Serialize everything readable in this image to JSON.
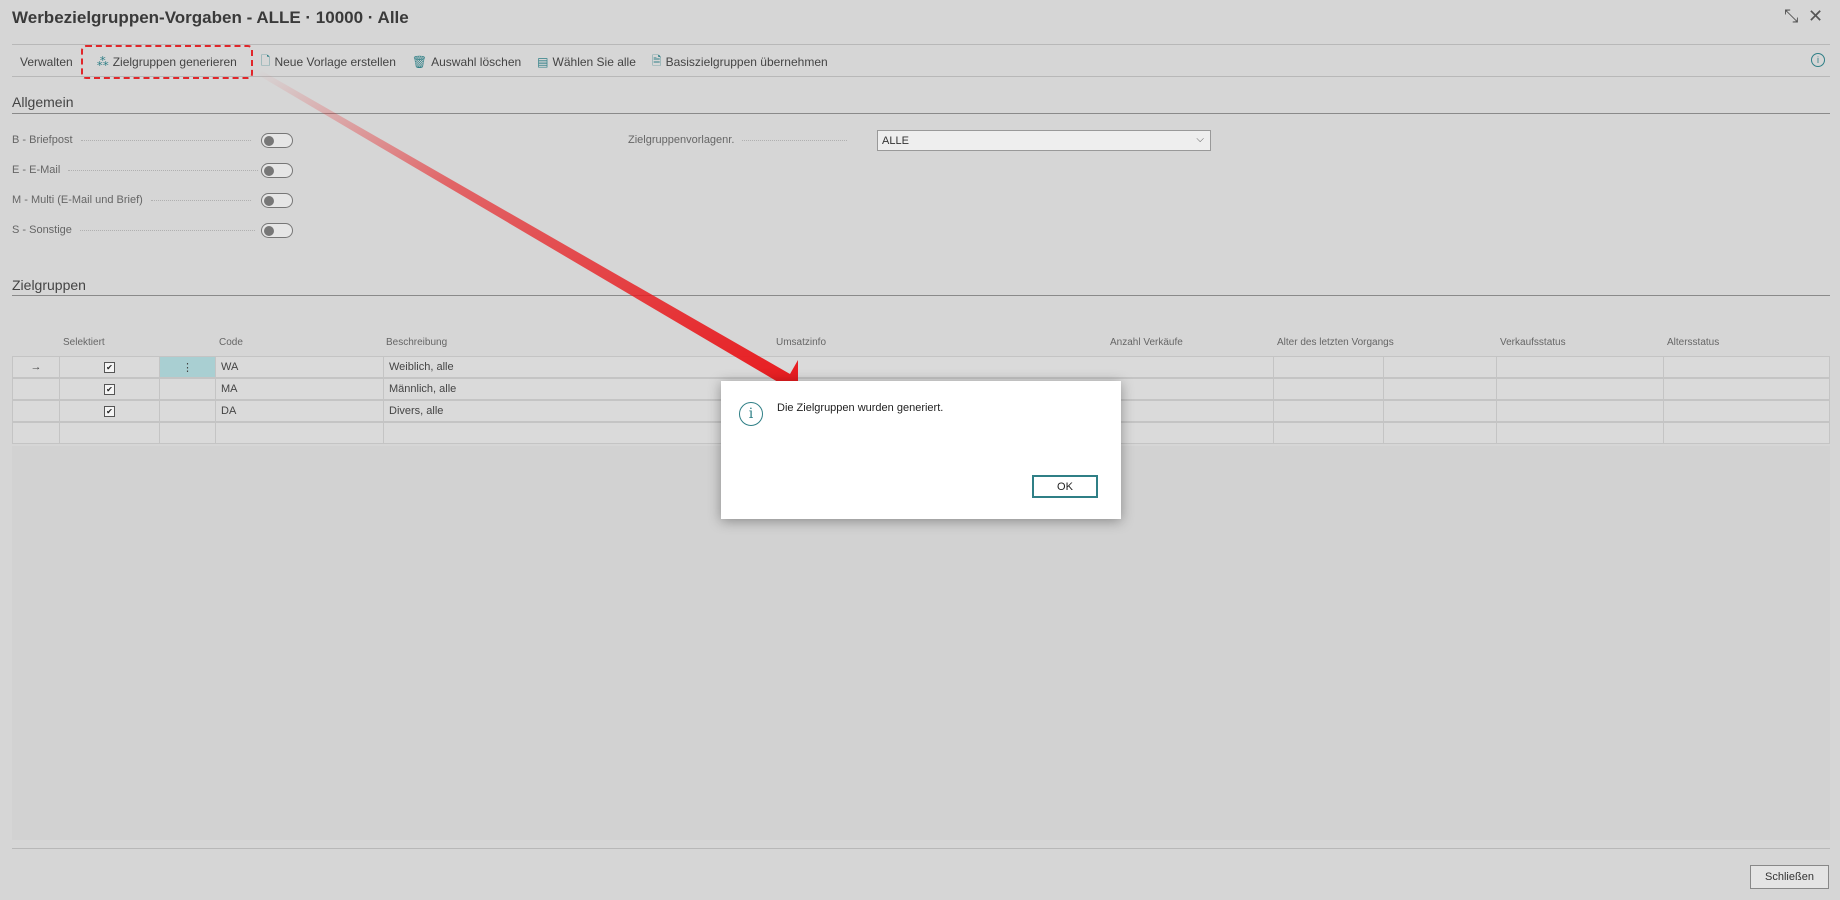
{
  "window": {
    "title": "Werbezielgruppen-Vorgaben - ALLE · 10000 · Alle"
  },
  "toolbar": {
    "verwalten": "Verwalten",
    "generate": "Zielgruppen generieren",
    "new_template": "Neue Vorlage erstellen",
    "delete_selection": "Auswahl löschen",
    "select_all": "Wählen Sie alle",
    "base_groups": "Basiszielgruppen übernehmen"
  },
  "general": {
    "heading": "Allgemein",
    "fields": [
      {
        "label": "B - Briefpost",
        "on": false
      },
      {
        "label": "E - E-Mail",
        "on": false
      },
      {
        "label": "M - Multi (E-Mail und Brief)",
        "on": false
      },
      {
        "label": "S - Sonstige",
        "on": false
      }
    ],
    "template_label": "Zielgruppenvorlagenr.",
    "template_value": "ALLE"
  },
  "groups": {
    "heading": "Zielgruppen",
    "columns": [
      "Selektiert",
      "Code",
      "Beschreibung",
      "Umsatzinfo",
      "Anzahl Verkäufe",
      "Alter des letzten Vorgangs",
      "Verkaufsstatus",
      "Altersstatus"
    ],
    "rows": [
      {
        "selected": true,
        "code": "WA",
        "description": "Weiblich, alle"
      },
      {
        "selected": true,
        "code": "MA",
        "description": "Männlich, alle"
      },
      {
        "selected": true,
        "code": "DA",
        "description": "Divers, alle"
      }
    ]
  },
  "footer": {
    "close": "Schließen"
  },
  "dialog": {
    "message": "Die Zielgruppen wurden generiert.",
    "ok": "OK"
  },
  "colors": {
    "accent": "#2f7f86",
    "highlight": "#e0262a",
    "arrow": "#e8191d"
  }
}
